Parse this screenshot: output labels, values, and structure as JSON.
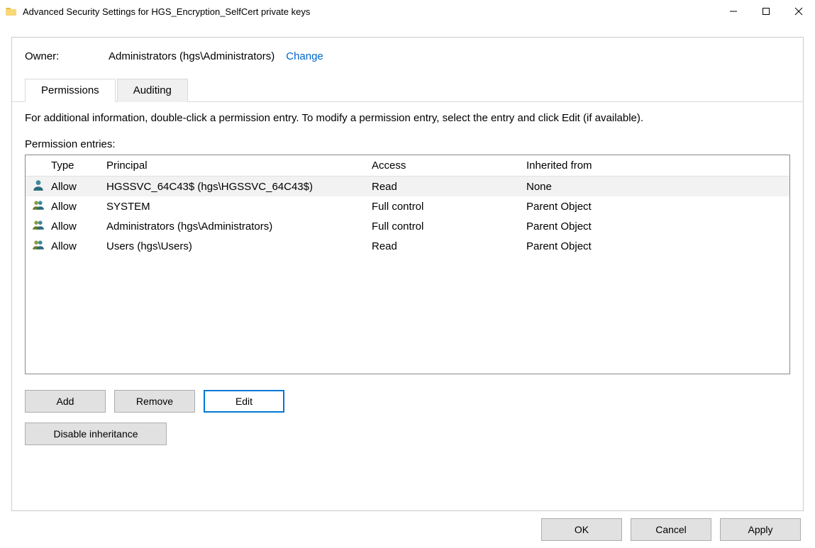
{
  "titlebar": {
    "title": "Advanced Security Settings for HGS_Encryption_SelfCert private keys"
  },
  "owner": {
    "label": "Owner:",
    "value": "Administrators (hgs\\Administrators)",
    "change": "Change"
  },
  "tabs": {
    "permissions": "Permissions",
    "auditing": "Auditing"
  },
  "instructions": "For additional information, double-click a permission entry. To modify a permission entry, select the entry and click Edit (if available).",
  "entries_label": "Permission entries:",
  "columns": {
    "type": "Type",
    "principal": "Principal",
    "access": "Access",
    "inherited": "Inherited from"
  },
  "entries": [
    {
      "type": "Allow",
      "principal": "HGSSVC_64C43$ (hgs\\HGSSVC_64C43$)",
      "access": "Read",
      "inherited": "None",
      "icon": "single"
    },
    {
      "type": "Allow",
      "principal": "SYSTEM",
      "access": "Full control",
      "inherited": "Parent Object",
      "icon": "group"
    },
    {
      "type": "Allow",
      "principal": "Administrators (hgs\\Administrators)",
      "access": "Full control",
      "inherited": "Parent Object",
      "icon": "group"
    },
    {
      "type": "Allow",
      "principal": "Users (hgs\\Users)",
      "access": "Read",
      "inherited": "Parent Object",
      "icon": "group"
    }
  ],
  "buttons": {
    "add": "Add",
    "remove": "Remove",
    "edit": "Edit",
    "disable_inheritance": "Disable inheritance",
    "ok": "OK",
    "cancel": "Cancel",
    "apply": "Apply"
  }
}
